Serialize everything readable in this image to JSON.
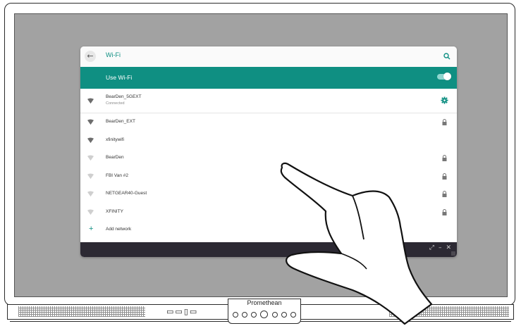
{
  "brand": "Promethean",
  "window": {
    "title": "Wi-Fi",
    "toggle_label": "Use Wi-Fi",
    "toggle_on": true,
    "accent_color": "#0f8f82",
    "networks": [
      {
        "name": "BearDen_5GEXT",
        "status": "Connected",
        "secured": false,
        "settings": true
      },
      {
        "name": "BearDen_EXT",
        "status": "",
        "secured": true
      },
      {
        "name": "xfinitywifi",
        "status": "",
        "secured": false
      },
      {
        "name": "BearDen",
        "status": "",
        "secured": true
      },
      {
        "name": "FBI Van #2",
        "status": "",
        "secured": true
      },
      {
        "name": "NETGEAR40-Guest",
        "status": "",
        "secured": true
      },
      {
        "name": "XFINITY",
        "status": "",
        "secured": true
      }
    ],
    "add_network_label": "Add network",
    "icons": {
      "back": "arrow-left-icon",
      "search": "search-icon",
      "signal": "wifi-signal-icon",
      "lock": "lock-icon",
      "settings": "gear-icon",
      "add": "plus-icon"
    }
  }
}
